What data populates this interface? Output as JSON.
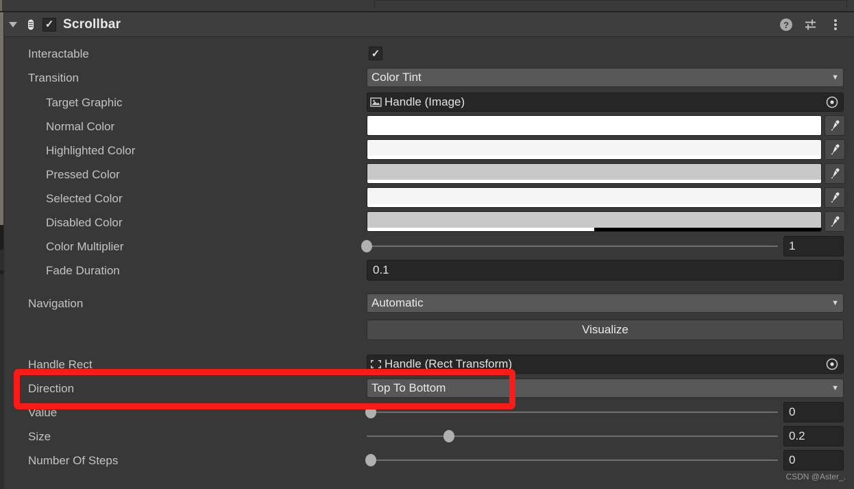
{
  "component": {
    "title": "Scrollbar",
    "enabled_checkbox": "✓",
    "foldout_expanded": true,
    "icons": {
      "help": "help-icon",
      "preset": "preset-icon",
      "menu": "kebab-menu-icon",
      "component": "scrollbar-component-icon"
    }
  },
  "properties": {
    "interactable": {
      "label": "Interactable",
      "value": "✓"
    },
    "transition": {
      "label": "Transition",
      "value": "Color Tint",
      "arrow": "▼"
    },
    "target_graphic": {
      "label": "Target Graphic",
      "value": "Handle (Image)"
    },
    "normal_color": {
      "label": "Normal Color",
      "color": "#ffffff",
      "alpha_pct": 100
    },
    "highlighted_color": {
      "label": "Highlighted Color",
      "color": "#f5f5f5",
      "alpha_pct": 100
    },
    "pressed_color": {
      "label": "Pressed Color",
      "color": "#c8c8c8",
      "alpha_pct": 100
    },
    "selected_color": {
      "label": "Selected Color",
      "color": "#f5f5f5",
      "alpha_pct": 100
    },
    "disabled_color": {
      "label": "Disabled Color",
      "color": "#c8c8c8",
      "alpha_pct": 50
    },
    "color_multiplier": {
      "label": "Color Multiplier",
      "value": "1",
      "slider_pct": 0
    },
    "fade_duration": {
      "label": "Fade Duration",
      "value": "0.1"
    },
    "navigation": {
      "label": "Navigation",
      "value": "Automatic",
      "arrow": "▼"
    },
    "visualize": {
      "label": "Visualize"
    },
    "handle_rect": {
      "label": "Handle Rect",
      "value": "Handle (Rect Transform)"
    },
    "direction": {
      "label": "Direction",
      "value": "Top To Bottom",
      "arrow": "▼"
    },
    "value": {
      "label": "Value",
      "value": "0",
      "slider_pct": 1
    },
    "size": {
      "label": "Size",
      "value": "0.2",
      "slider_pct": 20
    },
    "number_of_steps": {
      "label": "Number Of Steps",
      "value": "0",
      "slider_pct": 1
    }
  },
  "annotation": {
    "highlight_target": "Direction",
    "color": "#fb1c18"
  },
  "watermark": {
    "text": "CSDN @Aster_."
  }
}
